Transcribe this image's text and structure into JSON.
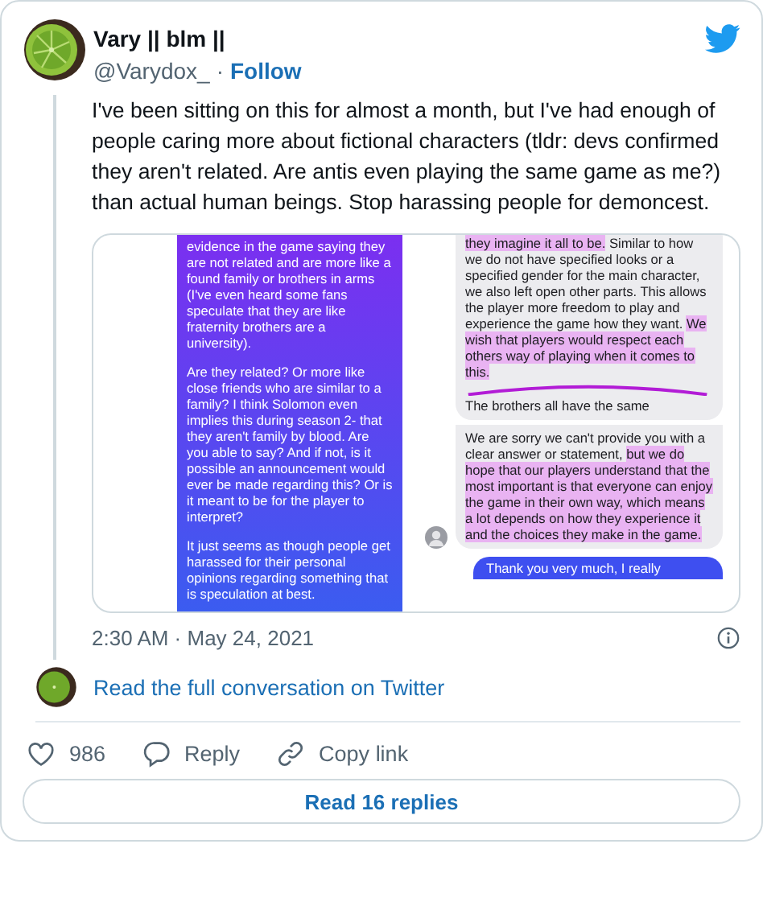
{
  "author": {
    "name": "Vary || blm ||",
    "handle": "@Varydox_",
    "separator": "·",
    "follow": "Follow"
  },
  "text": "I've been sitting on this for almost a month, but I've had enough of people caring more about fictional characters (tldr: devs confirmed they aren't related. Are antis even playing the same game as me?) than actual human beings. Stop harassing people for demoncest.",
  "image": {
    "left_bubble": [
      "evidence in the game saying they are not related and are more like a found family or brothers in arms (I've even heard some fans speculate that they are like fraternity brothers are a university).",
      "Are they related? Or more like close friends who are similar to a family? I think Solomon even implies this during season 2- that they aren't family by blood. Are you able to say? And if not, is it possible an announcement would ever be made regarding this? Or is it meant to be for the player to interpret?",
      "It just seems as though people get harassed for their personal opinions regarding something that is speculation at best."
    ],
    "right_bubbles": [
      {
        "paragraphs": [
          [
            {
              "text": "they imagine it all to be.",
              "highlighted": true
            },
            {
              "text": " Similar to how we do not have specified looks or a specified gender for the main character, we also left open other parts. This allows the player more freedom to play and experience the game how they want. ",
              "highlighted": false
            },
            {
              "text": "We wish that players would respect each others way of playing when it comes to this.",
              "highlighted": true
            }
          ],
          [
            {
              "text": "The brothers all have the same",
              "highlighted": false
            }
          ]
        ]
      },
      {
        "paragraphs": [
          [
            {
              "text": "We are sorry we can't provide you with a clear answer or statement, ",
              "highlighted": false
            },
            {
              "text": "but we do hope that our players understand that the most important is that everyone can enjoy the game in their own way, which means a lot depends on how they experience it and the choices they make in the game.",
              "highlighted": true
            }
          ]
        ]
      }
    ],
    "outgoing": "Thank you very much, I really"
  },
  "timestamp": "2:30 AM · May 24, 2021",
  "conversation_link": "Read the full conversation on Twitter",
  "actions": [
    {
      "kind": "like",
      "label": "986"
    },
    {
      "kind": "reply",
      "label": "Reply"
    },
    {
      "kind": "copy",
      "label": "Copy link"
    }
  ],
  "replies_button": "Read 16 replies"
}
